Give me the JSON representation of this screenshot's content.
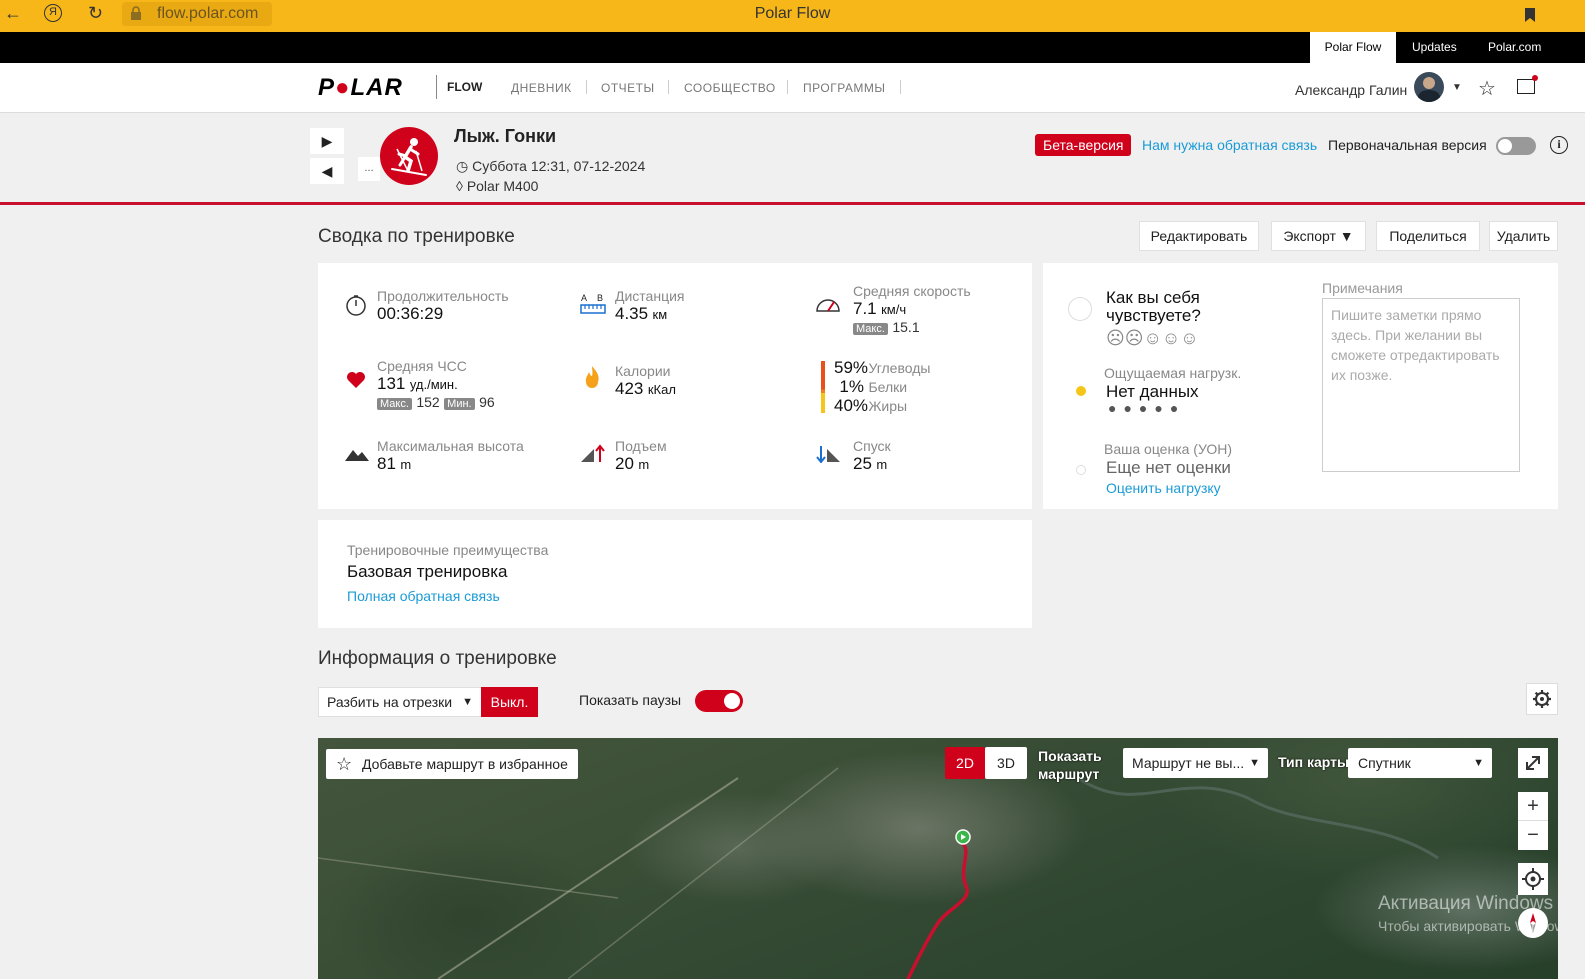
{
  "browser": {
    "url": "flow.polar.com",
    "title": "Polar Flow"
  },
  "topbar": {
    "links": [
      "Polar Flow",
      "Updates",
      "Polar.com"
    ]
  },
  "nav": {
    "logo": "POLAR",
    "product": "FLOW",
    "items": [
      "ДНЕВНИК",
      "ОТЧЕТЫ",
      "СООБЩЕСТВО",
      "ПРОГРАММЫ"
    ],
    "username": "Александр Галин"
  },
  "session": {
    "title": "Лыж. Гонки",
    "date": "Суббота 12:31, 07-12-2024",
    "device": "Polar M400",
    "more": "...",
    "beta": "Бета-версия",
    "feedback": "Нам нужна обратная связь",
    "original_version": "Первоначальная версия"
  },
  "summary": {
    "title": "Сводка по тренировке",
    "actions": [
      "Редактировать",
      "Экспорт",
      "Поделиться",
      "Удалить"
    ],
    "duration": {
      "label": "Продолжительность",
      "value": "00:36:29"
    },
    "distance": {
      "label": "Дистанция",
      "value": "4.35",
      "unit": "км"
    },
    "avg_speed": {
      "label": "Средняя скорость",
      "value": "7.1",
      "unit": "км/ч",
      "max_label": "Макс.",
      "max_value": "15.1"
    },
    "avg_hr": {
      "label": "Средняя ЧСС",
      "value": "131",
      "unit": "уд./мин.",
      "max_label": "Макс.",
      "max_value": "152",
      "min_label": "Мин.",
      "min_value": "96"
    },
    "calories": {
      "label": "Калории",
      "value": "423",
      "unit": "кКал"
    },
    "nutrition": [
      {
        "pct": "59%",
        "label": "Углеводы",
        "color": "#e8501c"
      },
      {
        "pct": "1%",
        "label": "Белки",
        "color": "#f07f1e"
      },
      {
        "pct": "40%",
        "label": "Жиры",
        "color": "#f5c518"
      }
    ],
    "max_altitude": {
      "label": "Максимальная высота",
      "value": "81",
      "unit": "m"
    },
    "ascent": {
      "label": "Подъем",
      "value": "20",
      "unit": "m"
    },
    "descent": {
      "label": "Спуск",
      "value": "25",
      "unit": "m"
    }
  },
  "feeling": {
    "question": "Как вы себя чувствуете?",
    "smileys": "☹☹☺☺☺",
    "perceived_label": "Ощущаемая нагрузк.",
    "perceived_value": "Нет данных",
    "dots": "●●●●●",
    "rpe_label": "Ваша оценка (УОН)",
    "rpe_value": "Еще нет оценки",
    "rpe_link": "Оценить нагрузку"
  },
  "notes": {
    "label": "Примечания",
    "placeholder": "Пишите заметки прямо здесь. При желании вы сможете отредактировать их позже."
  },
  "benefit": {
    "label": "Тренировочные преимущества",
    "value": "Базовая тренировка",
    "link": "Полная обратная связь"
  },
  "details": {
    "title": "Информация о тренировке",
    "split_select": "Разбить на отрезки",
    "off_button": "Выкл.",
    "show_pauses": "Показать паузы"
  },
  "map": {
    "favorite": "Добавьте маршрут в избранное",
    "mode_2d": "2D",
    "mode_3d": "3D",
    "show_route": "Показать маршрут",
    "route_select": "Маршрут не вы...",
    "map_type_label": "Тип карты",
    "map_type": "Спутник",
    "zoom_in": "+",
    "zoom_out": "−",
    "watermark_title": "Активация Windows",
    "watermark_sub": "Чтобы активировать Windows"
  },
  "colors": {
    "brand_red": "#d0021b",
    "browser_yellow": "#f7b718",
    "link_blue": "#1a9bd7"
  }
}
